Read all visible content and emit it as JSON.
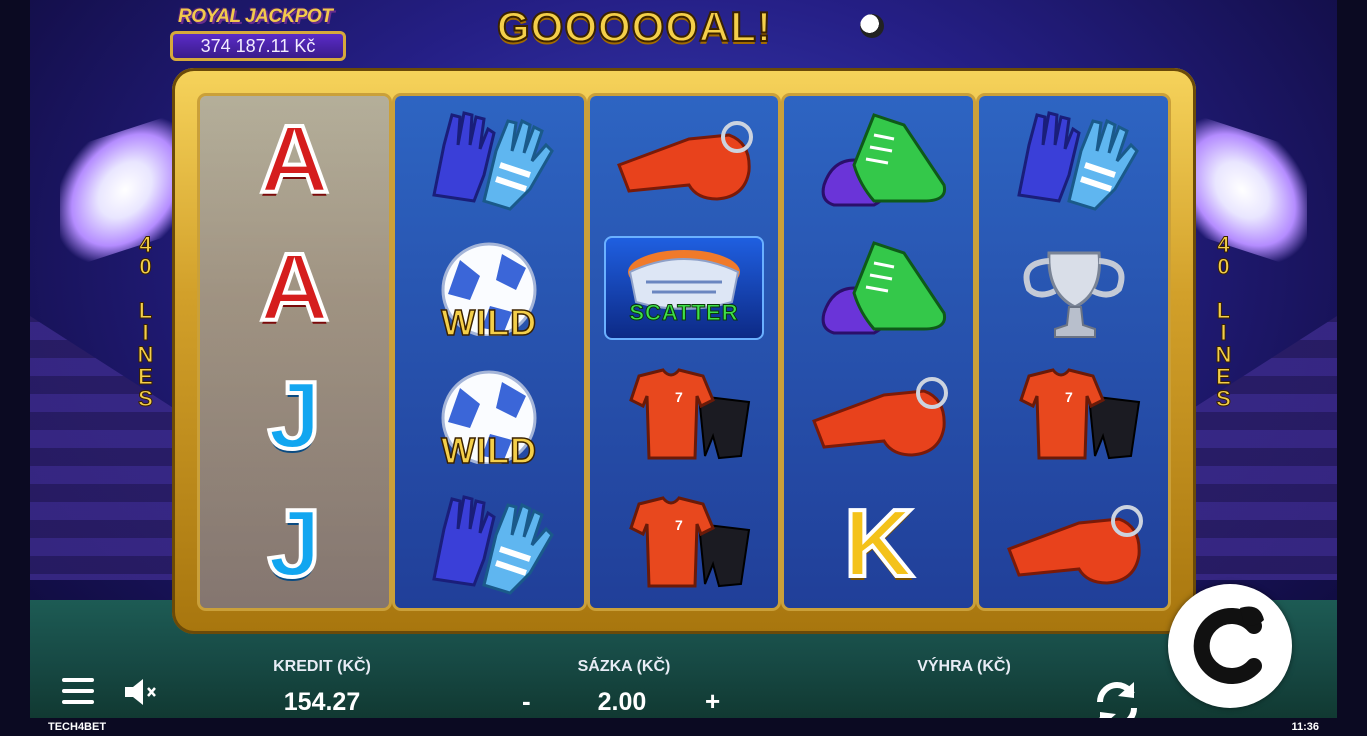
{
  "jackpot": {
    "title": "ROYAL JACKPOT",
    "amount": "374 187.11 Kč"
  },
  "logo": "GOOOOOAL!",
  "lines_label": "40 LINES",
  "reels": [
    [
      "A",
      "A",
      "J",
      "J"
    ],
    [
      "goalkeeper-gloves",
      "wild-ball",
      "wild-ball",
      "goalkeeper-gloves"
    ],
    [
      "whistle",
      "scatter-stadium",
      "jersey-kit",
      "jersey-kit"
    ],
    [
      "football-boots",
      "football-boots",
      "whistle",
      "K"
    ],
    [
      "goalkeeper-gloves",
      "trophy",
      "jersey-kit",
      "whistle"
    ]
  ],
  "symbols": {
    "wild": "WILD",
    "scatter": "SCATTER",
    "letter_a": "A",
    "letter_j": "J",
    "letter_k": "K"
  },
  "controls": {
    "credit_label": "KREDIT (KČ)",
    "credit_value": "154.27",
    "bet_label": "SÁZKA (KČ)",
    "bet_value": "2.00",
    "bet_minus": "-",
    "bet_plus": "+",
    "win_label": "VÝHRA (KČ)"
  },
  "footer": {
    "brand": "TECH4BET",
    "clock": "11:36"
  },
  "colors": {
    "gold": "#f4cf4a",
    "reel_blue": "#235fc8",
    "accent_red": "#d51d1d"
  }
}
